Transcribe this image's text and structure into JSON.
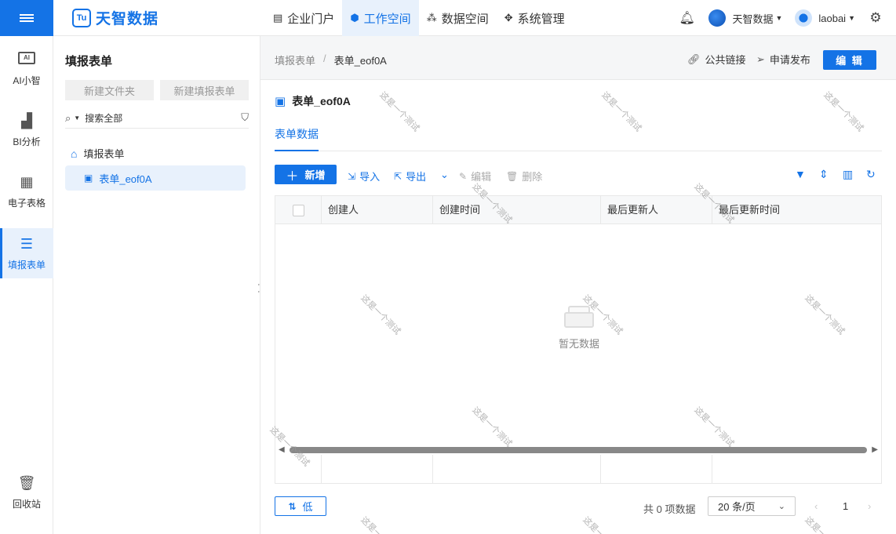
{
  "brand": {
    "name": "天智数据",
    "mark": "Tu"
  },
  "nav": [
    {
      "label": "企业门户",
      "icon": "portal-icon"
    },
    {
      "label": "工作空间",
      "icon": "cube-icon",
      "active": true
    },
    {
      "label": "数据空间",
      "icon": "data-space-icon"
    },
    {
      "label": "系统管理",
      "icon": "grid-icon"
    }
  ],
  "header_right": {
    "tenant": "天智数据",
    "user": "laobai"
  },
  "rail": {
    "items": [
      {
        "label": "AI小智",
        "icon": "ai-icon"
      },
      {
        "label": "BI分析",
        "icon": "bar-chart-icon"
      },
      {
        "label": "电子表格",
        "icon": "spreadsheet-icon"
      },
      {
        "label": "填报表单",
        "icon": "form-icon",
        "active": true
      }
    ],
    "recycle": "回收站",
    "ai_badge": "AI"
  },
  "tree": {
    "title": "填报表单",
    "new_folder": "新建文件夹",
    "new_form": "新建填报表单",
    "search_placeholder": "搜索全部",
    "root": "填报表单",
    "selected_node": "表单_eof0A"
  },
  "breadcrumb": {
    "parent": "填报表单",
    "sep": "/",
    "current": "表单_eof0A"
  },
  "actions": {
    "public_link": "公共链接",
    "publish": "申请发布",
    "edit": "编 辑"
  },
  "form": {
    "title": "表单_eof0A",
    "tab": "表单数据"
  },
  "toolbar": {
    "add": "新增",
    "import": "导入",
    "export": "导出",
    "edit": "编辑",
    "delete": "删除"
  },
  "table": {
    "columns": [
      "创建人",
      "创建时间",
      "最后更新人",
      "最后更新时间"
    ],
    "empty_text": "暂无数据"
  },
  "footer": {
    "sort": "低",
    "total": "共 0 项数据",
    "page_size": "20 条/页",
    "current_page": "1"
  },
  "watermark": "这是一个测试",
  "colors": {
    "primary": "#1473e6",
    "primary_light": "#e8f1fc"
  }
}
